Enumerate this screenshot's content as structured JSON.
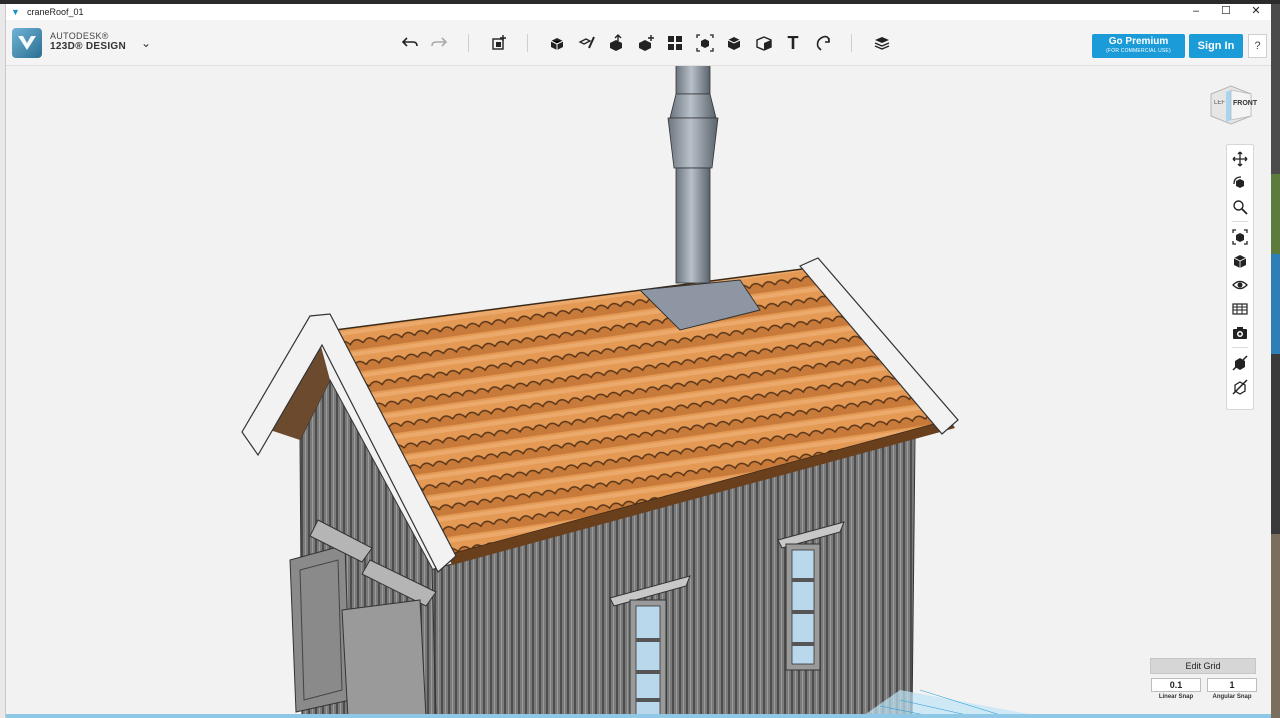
{
  "window": {
    "title": "craneRoof_01",
    "controls": {
      "minimize": "–",
      "maximize": "☐",
      "close": "✕"
    }
  },
  "brand": {
    "line1": "AUTODESK®",
    "line2": "123D® DESIGN",
    "menu_chevron": "⌄"
  },
  "toolbar": {
    "tools": [
      {
        "name": "undo-icon"
      },
      {
        "name": "redo-icon"
      },
      {
        "name": "transform-icon"
      },
      {
        "name": "primitives-icon"
      },
      {
        "name": "sketch-icon"
      },
      {
        "name": "construct-icon"
      },
      {
        "name": "modify-icon"
      },
      {
        "name": "pattern-icon"
      },
      {
        "name": "grouping-icon"
      },
      {
        "name": "combine-icon"
      },
      {
        "name": "measure-icon"
      },
      {
        "name": "text-icon"
      },
      {
        "name": "snap-icon"
      },
      {
        "name": "material-icon"
      }
    ],
    "text_tool_glyph": "T"
  },
  "account": {
    "premium_label": "Go Premium",
    "premium_sub": "(FOR COMMERCIAL USE)",
    "signin_label": "Sign In",
    "help_label": "?"
  },
  "viewcube": {
    "left_face": "LEFT",
    "front_face": "FRONT"
  },
  "navigation": [
    {
      "name": "pan-icon"
    },
    {
      "name": "orbit-icon"
    },
    {
      "name": "zoom-icon"
    },
    {
      "name": "fit-icon"
    },
    {
      "name": "view-icon"
    },
    {
      "name": "visibility-icon"
    },
    {
      "name": "materials-icon"
    },
    {
      "name": "camera-icon"
    },
    {
      "name": "hide-icon"
    },
    {
      "name": "show-icon"
    }
  ],
  "grid": {
    "title": "Edit Grid",
    "linear_value": "0.1",
    "linear_label": "Linear Snap",
    "angular_value": "1",
    "angular_label": "Angular Snap"
  },
  "colors": {
    "accent": "#1b9bd7",
    "roof_tile": "#e39553",
    "wall": "#6f6f6f",
    "chimney": "#8f98a3"
  }
}
